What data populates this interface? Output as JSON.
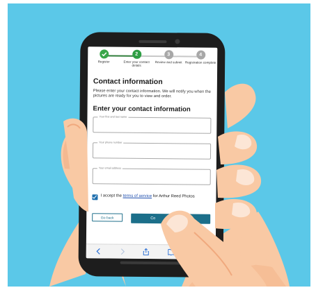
{
  "progress": {
    "steps": [
      {
        "number": "",
        "label": "Register",
        "state": "done"
      },
      {
        "number": "2",
        "label": "Enter your contact details",
        "state": "current"
      },
      {
        "number": "3",
        "label": "Review and submit",
        "state": "todo"
      },
      {
        "number": "4",
        "label": "Registration complete",
        "state": "todo"
      }
    ]
  },
  "page": {
    "title": "Contact information",
    "intro": "Please enter your contact information. We will notify you when the pictures are ready for you to view and order.",
    "form_title": "Enter your contact information"
  },
  "form": {
    "name_label": "Your first and last name",
    "phone_label": "Your phone number",
    "email_label": "Your email address"
  },
  "consent": {
    "prefix": "I accept the ",
    "link": "terms of service",
    "suffix": " for Arthur Reed Photos",
    "checked": true
  },
  "buttons": {
    "back": "Go back",
    "continue": "Co"
  },
  "browser": {
    "icons": [
      "back-arrow-icon",
      "forward-arrow-icon",
      "share-icon",
      "bookmarks-icon",
      "tabs-icon"
    ]
  },
  "colors": {
    "background": "#5bc8e8",
    "skin": "#f9c9a4",
    "skin_shadow": "#f0a97e",
    "primary": "#1c6f8a",
    "success": "#3aa64a",
    "phone_body": "#1d1d1d"
  }
}
